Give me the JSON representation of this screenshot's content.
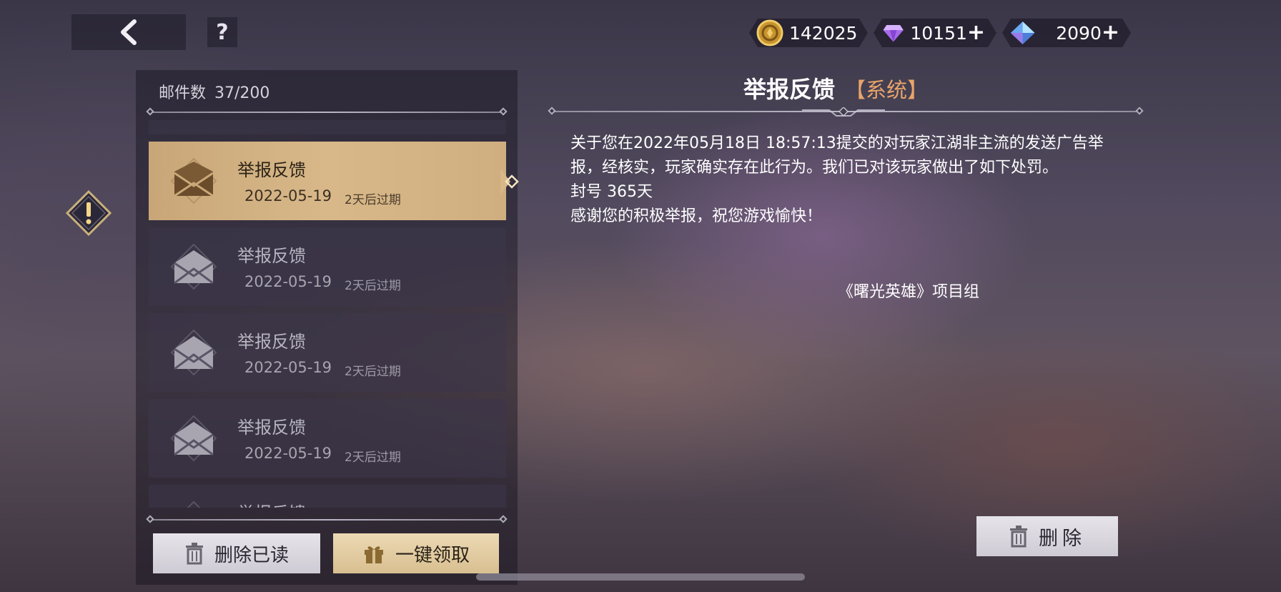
{
  "currency": {
    "gold": {
      "value": "142025",
      "icon": "gold-coin-icon"
    },
    "diamond": {
      "value": "10151",
      "icon": "purple-diamond-icon",
      "plus": "+"
    },
    "crystal": {
      "value": "2090",
      "icon": "blue-crystal-icon",
      "plus": "+"
    }
  },
  "header": {
    "help_label": "?"
  },
  "mail": {
    "count_label": "邮件数",
    "count_value": "37/200",
    "items": [
      {
        "title": "举报反馈",
        "date": "2022-05-19",
        "expire": "2天后过期",
        "selected": true
      },
      {
        "title": "举报反馈",
        "date": "2022-05-19",
        "expire": "2天后过期"
      },
      {
        "title": "举报反馈",
        "date": "2022-05-19",
        "expire": "2天后过期"
      },
      {
        "title": "举报反馈",
        "date": "2022-05-19",
        "expire": "2天后过期"
      },
      {
        "title": "举报反馈",
        "date": "",
        "expire": ""
      }
    ],
    "delete_read_label": "删除已读",
    "claim_all_label": "一键领取"
  },
  "detail": {
    "title": "举报反馈",
    "tag": "【系统】",
    "lines": [
      "关于您在2022年05月18日 18:57:13提交的对玩家江湖非主流的发送广告举报，经核实，玩家确实存在此行为。我们已对该玩家做出了如下处罚。",
      "封号 365天",
      "感谢您的积极举报，祝您游戏愉快！"
    ],
    "signature": "《曙光英雄》项目组",
    "delete_label": "删除"
  },
  "colors": {
    "selected_item": "#d8b888",
    "tag": "#e8a46a",
    "claim_button": "#ecd9b4"
  }
}
